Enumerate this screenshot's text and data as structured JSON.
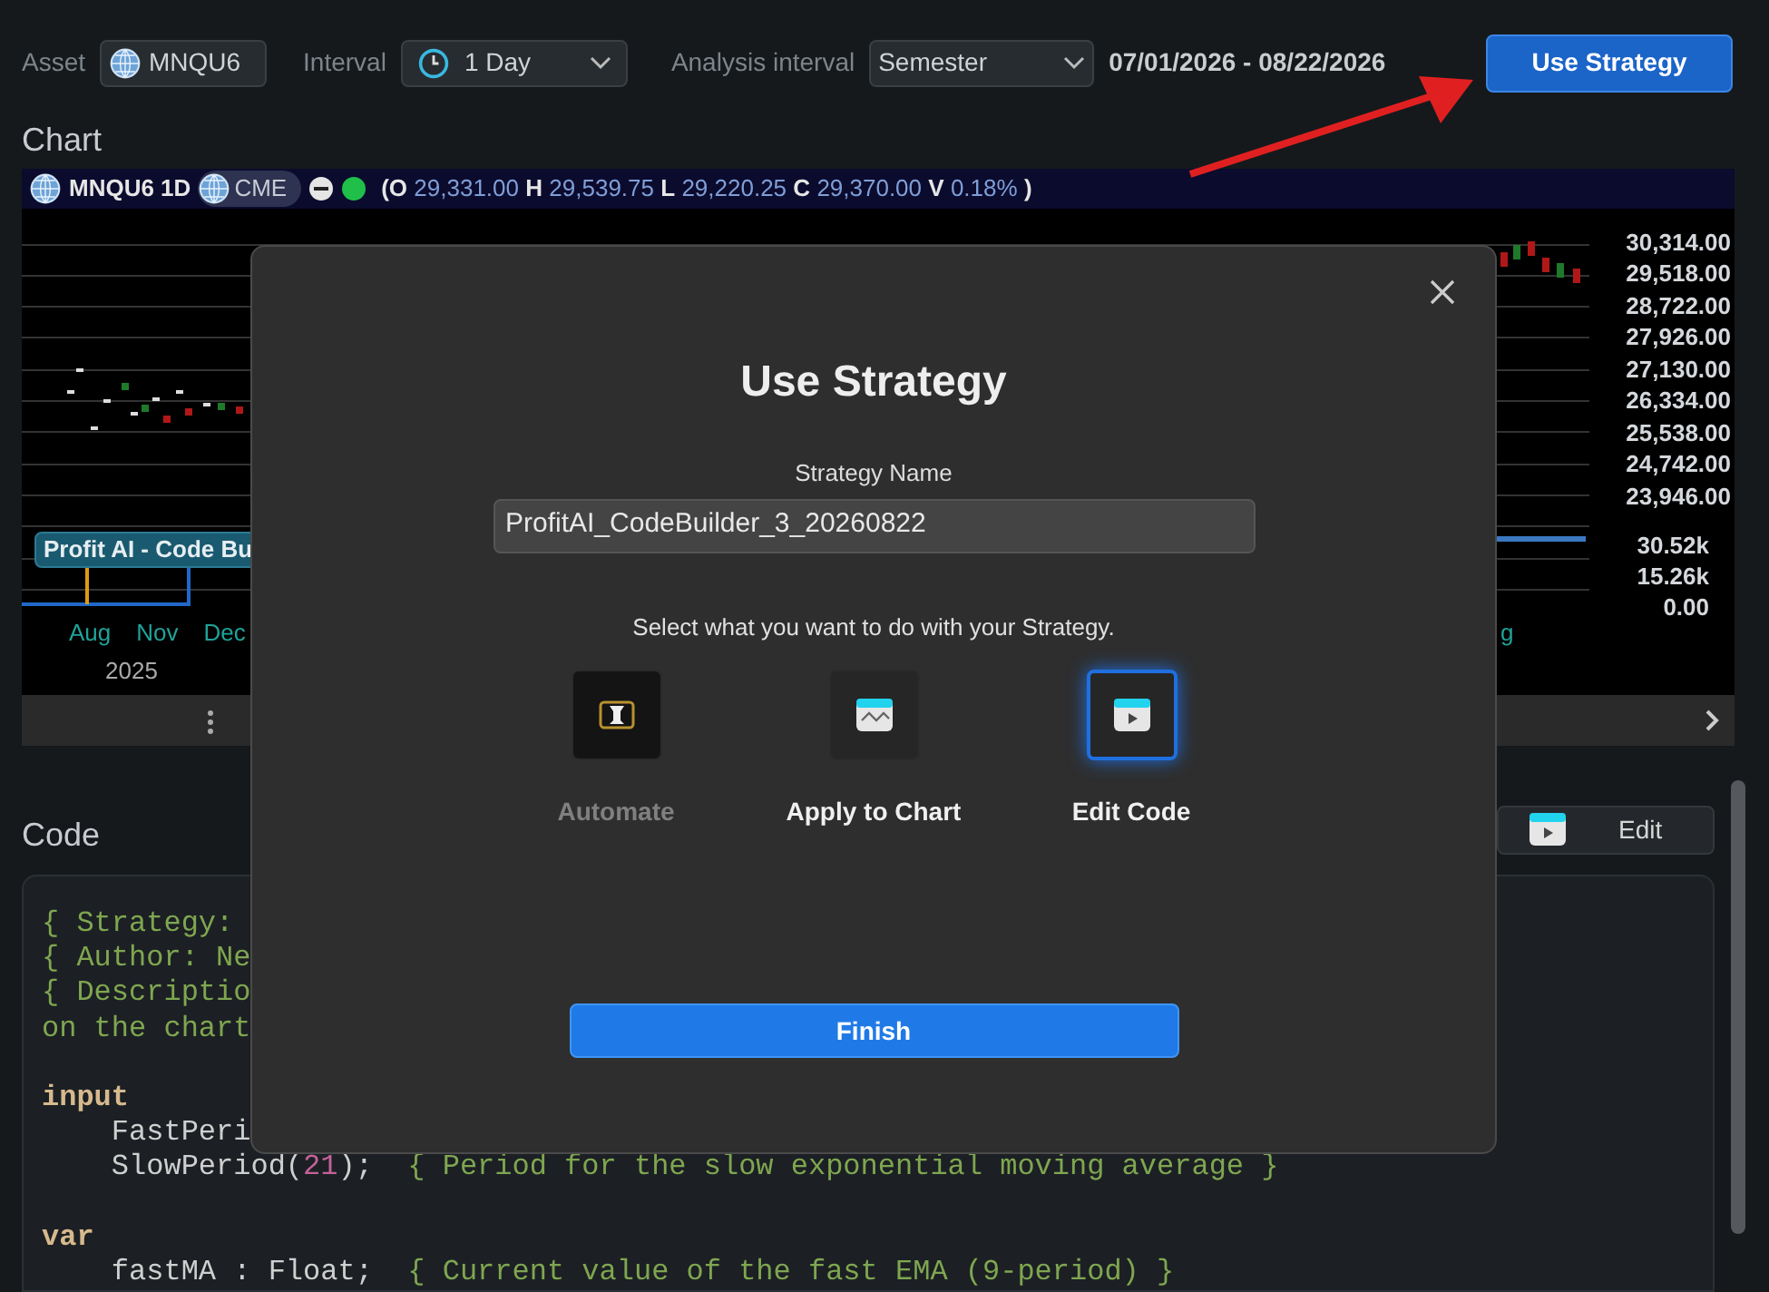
{
  "toolbar": {
    "asset_label": "Asset",
    "asset": "MNQU6",
    "interval_label": "Interval",
    "interval": "1 Day",
    "analysis_label": "Analysis interval",
    "analysis": "Semester",
    "date_range": "07/01/2026 - 08/22/2026",
    "button": "Use Strategy"
  },
  "chart": {
    "title": "Chart",
    "symbol": "MNQU6 1D",
    "exchange": "CME",
    "ohlc_open": "(",
    "ohlc": [
      {
        "label": "O",
        "value": "29,331.00"
      },
      {
        "label": "H",
        "value": "29,539.75"
      },
      {
        "label": "L",
        "value": "29,220.25"
      },
      {
        "label": "C",
        "value": "29,370.00"
      },
      {
        "label": "V",
        "value": "0.18%"
      }
    ],
    "ohlc_close": ")",
    "legend": "Profit AI - Code Bu",
    "price_axis": [
      "30,314.00",
      "29,518.00",
      "28,722.00",
      "27,926.00",
      "27,130.00",
      "26,334.00",
      "25,538.00",
      "24,742.00",
      "23,946.00"
    ],
    "volume_axis": [
      "30.52k",
      "15.26k",
      "0.00"
    ],
    "months": [
      "Aug",
      "Nov",
      "Dec"
    ],
    "month_right": "g",
    "year": "2025"
  },
  "code": {
    "title": "Code",
    "edit_button": "Edit",
    "lines": [
      [
        {
          "kind": "comment",
          "text": "{ Strategy:"
        }
      ],
      [
        {
          "kind": "comment",
          "text": "{ Author: Ne"
        }
      ],
      [
        {
          "kind": "comment",
          "text": "{ Descriptio"
        }
      ],
      [
        {
          "kind": "comment",
          "text": "on the chart"
        }
      ],
      {
        "kind": "blank"
      },
      [
        {
          "kind": "keyword",
          "text": "input"
        }
      ],
      [
        {
          "kind": "plain",
          "text": "    FastPeri"
        }
      ],
      [
        {
          "kind": "plain",
          "text": "    SlowPeriod("
        },
        {
          "kind": "number",
          "text": "21"
        },
        {
          "kind": "plain",
          "text": ");  "
        },
        {
          "kind": "comment",
          "text": "{ Period for the slow exponential moving average }"
        }
      ],
      {
        "kind": "blank"
      },
      [
        {
          "kind": "keyword",
          "text": "var"
        }
      ],
      [
        {
          "kind": "plain",
          "text": "    fastMA : Float;  "
        },
        {
          "kind": "comment",
          "text": "{ Current value of the fast EMA (9-period) }"
        }
      ]
    ]
  },
  "dialog": {
    "title": "Use Strategy",
    "name_label": "Strategy Name",
    "name_value": "ProfitAI_CodeBuilder_3_20260822",
    "prompt": "Select what you want to do with your Strategy.",
    "options": [
      {
        "kind": "automate",
        "label": "Automate",
        "disabled": true,
        "selected": false
      },
      {
        "kind": "chart",
        "label": "Apply to Chart",
        "disabled": false,
        "selected": false
      },
      {
        "kind": "code",
        "label": "Edit Code",
        "disabled": false,
        "selected": true
      }
    ],
    "finish": "Finish"
  }
}
